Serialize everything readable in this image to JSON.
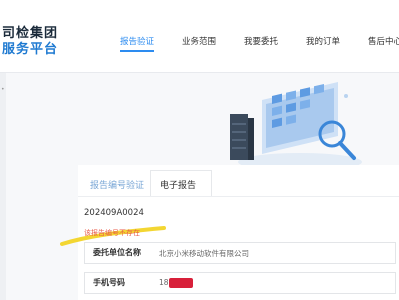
{
  "brand": {
    "line1": "司检集团",
    "line2": "服务平台"
  },
  "nav": {
    "items": [
      {
        "label": "报告验证",
        "active": true
      },
      {
        "label": "业务范围",
        "active": false
      },
      {
        "label": "我要委托",
        "active": false
      },
      {
        "label": "我的订单",
        "active": false
      },
      {
        "label": "售后中心",
        "active": false
      }
    ]
  },
  "tabs": {
    "verify": "报告编号验证",
    "ereport": "电子报告"
  },
  "form": {
    "report_number": "202409A0024",
    "error_message": "该报告编号不存在",
    "company_label": "委托单位名称",
    "company_value": "北京小米移动软件有限公司",
    "phone_label": "手机号码",
    "phone_value": "18"
  },
  "colors": {
    "accent": "#2d8cf0",
    "error": "#e85a47",
    "highlight": "#f2d21c",
    "redaction": "#d8203a"
  }
}
